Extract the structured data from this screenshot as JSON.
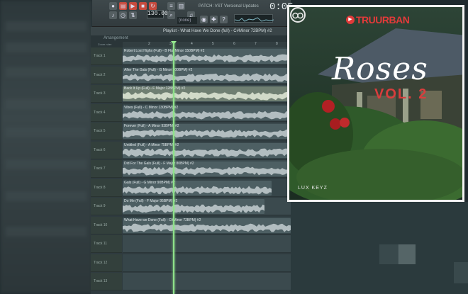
{
  "toolbar": {
    "tempo": "130.000",
    "hint": "PATCH: VST Versional Updates",
    "time": "0:05",
    "preset": "(none)"
  },
  "playlist": {
    "title": "Playlist - What Have We Done (full) - C#Minor 72BPM) #2",
    "subtitle": "Arrangement",
    "ruler_head": "Zoom ruler",
    "ruler_marks": [
      "2",
      "3",
      "4",
      "5",
      "6",
      "7",
      "8"
    ],
    "tracks": [
      {
        "label": "Track 1",
        "clip": "Robert Lost Highs (Full) - B Flat Minor 150BPM) #2",
        "selected": false
      },
      {
        "label": "Track 2",
        "clip": "After The Gals (Full) - G Minor 100BPM) #2",
        "selected": false
      },
      {
        "label": "Track 3",
        "clip": "Back It Up (Full) - F Major 128BPM) #2",
        "selected": true
      },
      {
        "label": "Track 4",
        "clip": "Vibes (Full) - C Minor 130BPM) #2",
        "selected": false
      },
      {
        "label": "Track 5",
        "clip": "Forever (Full) - A Minor 93BPM) #2",
        "selected": false
      },
      {
        "label": "Track 6",
        "clip": "Untitled (Full) - A Minor 75BPM) #2",
        "selected": false
      },
      {
        "label": "Track 7",
        "clip": "Did For The Gals (Full) - F Major 80BPM) #2",
        "selected": false
      },
      {
        "label": "Track 8",
        "clip": "Gals (Full) - G Minor 90BPM) #2",
        "selected": false
      },
      {
        "label": "Track 9",
        "clip": "Do Me (Full) - F Major 95BPM) #2",
        "selected": false
      },
      {
        "label": "Track 10",
        "clip": "What Have we Done (Full) - C#Minor 72BPM) #2",
        "selected": false
      },
      {
        "label": "Track 11",
        "clip": "",
        "selected": false
      },
      {
        "label": "Track 12",
        "clip": "",
        "selected": false
      },
      {
        "label": "Track 13",
        "clip": "",
        "selected": false
      }
    ]
  },
  "cover": {
    "brand": "TRUURBAN",
    "title": "Roses",
    "subtitle": "VOL. 2",
    "producer": "LUX KEYZ"
  },
  "colors": {
    "playhead": "#8fe28a",
    "brand_red": "#e23a3a",
    "lane": "#3b4a4e"
  }
}
